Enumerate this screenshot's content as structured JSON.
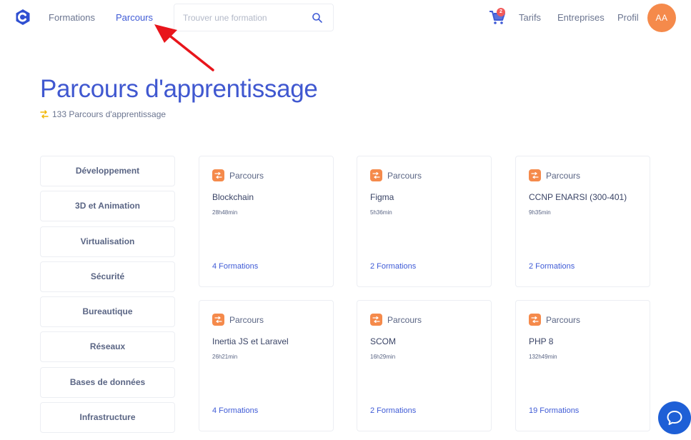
{
  "header": {
    "nav": {
      "formations": "Formations",
      "parcours": "Parcours",
      "tarifs": "Tarifs",
      "entreprises": "Entreprises",
      "profil": "Profil"
    },
    "search": {
      "placeholder": "Trouver une formation",
      "value": ""
    },
    "cart_badge": "2",
    "avatar": "AA",
    "active_nav": "parcours"
  },
  "page": {
    "title": "Parcours d'apprentissage",
    "count_text": "133 Parcours d'apprentissage"
  },
  "categories": [
    {
      "label": "Développement"
    },
    {
      "label": "3D et Animation"
    },
    {
      "label": "Virtualisation"
    },
    {
      "label": "Sécurité"
    },
    {
      "label": "Bureautique"
    },
    {
      "label": "Réseaux"
    },
    {
      "label": "Bases de données"
    },
    {
      "label": "Infrastructure"
    }
  ],
  "cards": [
    {
      "type": "Parcours",
      "title": "Blockchain",
      "duration": "28h48min",
      "formations": "4 Formations"
    },
    {
      "type": "Parcours",
      "title": "Figma",
      "duration": "5h36min",
      "formations": "2 Formations"
    },
    {
      "type": "Parcours",
      "title": "CCNP ENARSI (300-401)",
      "duration": "9h35min",
      "formations": "2 Formations"
    },
    {
      "type": "Parcours",
      "title": "Inertia JS et Laravel",
      "duration": "26h21min",
      "formations": "4 Formations"
    },
    {
      "type": "Parcours",
      "title": "SCOM",
      "duration": "16h29min",
      "formations": "2 Formations"
    },
    {
      "type": "Parcours",
      "title": "PHP 8",
      "duration": "132h49min",
      "formations": "19 Formations"
    }
  ],
  "colors": {
    "primary": "#4058d0",
    "accent_orange": "#f58a4b",
    "badge_red": "#f25a5a",
    "chat_blue": "#1e5fd6",
    "annotation_red": "#e8151b"
  },
  "icons": {
    "logo": "brand-logo-icon",
    "search": "search-icon",
    "cart": "cart-icon",
    "parcours": "path-icon",
    "chat": "chat-bubble-icon",
    "annotation": "red-arrow-annotation"
  }
}
